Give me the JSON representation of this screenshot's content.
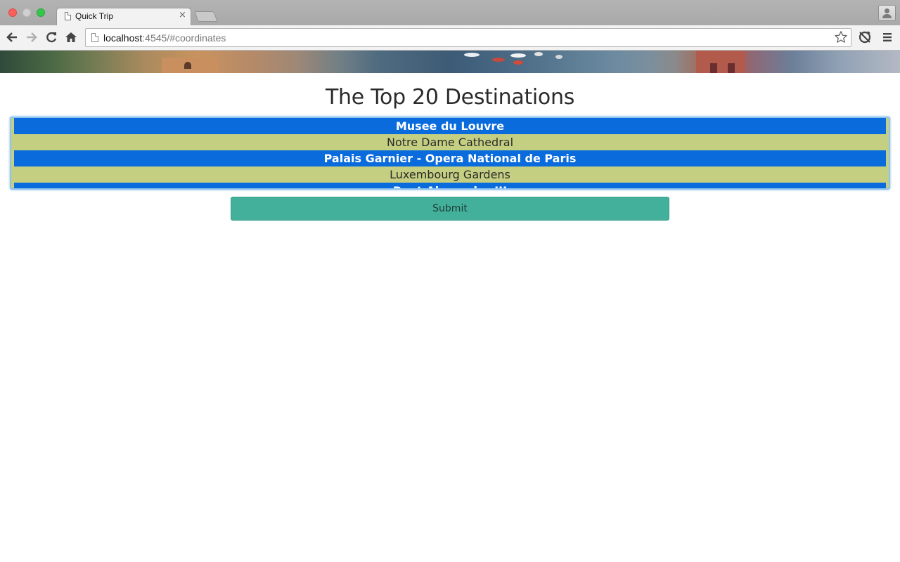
{
  "browser": {
    "tab_title": "Quick Trip",
    "tab_close_glyph": "×",
    "url_host": "localhost",
    "url_rest": ":4545/#coordinates",
    "icons": {
      "back": "back-arrow-icon",
      "forward": "forward-arrow-icon",
      "reload": "reload-icon",
      "home": "home-icon",
      "bookmark": "star-icon",
      "extension": "sync-icon",
      "menu": "hamburger-menu-icon",
      "profile": "profile-icon"
    }
  },
  "page": {
    "title": "The Top 20 Destinations",
    "destinations": [
      {
        "label": "Musee du Louvre",
        "selected": true
      },
      {
        "label": "Notre Dame Cathedral",
        "selected": false
      },
      {
        "label": "Palais Garnier - Opera National de Paris",
        "selected": true
      },
      {
        "label": "Luxembourg Gardens",
        "selected": false
      },
      {
        "label": "Pont Alexandre III",
        "selected": true
      }
    ],
    "submit_label": "Submit",
    "colors": {
      "selected_option": "#0a6bdd",
      "unselected_option": "#c5cf82",
      "submit_button": "#42b09a"
    }
  }
}
